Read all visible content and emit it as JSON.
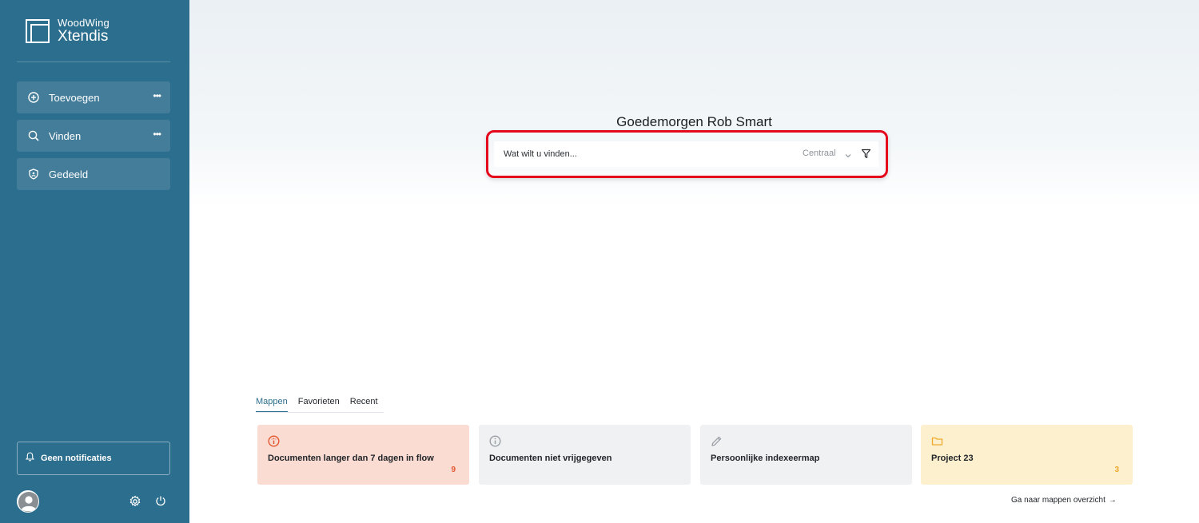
{
  "brand": {
    "line1": "WoodWing",
    "line2": "Xtendis",
    "logo_icon": "xtendis-logo-icon"
  },
  "sidebar": {
    "items": [
      {
        "label": "Toevoegen",
        "icon": "plus-circle-icon",
        "more": "•••"
      },
      {
        "label": "Vinden",
        "icon": "search-icon",
        "more": "•••"
      },
      {
        "label": "Gedeeld",
        "icon": "shield-icon"
      }
    ],
    "notifications_label": "Geen notificaties",
    "notifications_icon": "bell-icon",
    "avatar_icon": "user-avatar-icon",
    "settings_icon": "gear-icon",
    "power_icon": "power-icon"
  },
  "main": {
    "greeting": "Goedemorgen Rob Smart",
    "search": {
      "placeholder": "Wat wilt u vinden...",
      "scope": "Centraal",
      "filter_icon": "filter-icon"
    },
    "tabs": [
      {
        "label": "Mappen",
        "active": true
      },
      {
        "label": "Favorieten",
        "active": false
      },
      {
        "label": "Recent",
        "active": false
      }
    ],
    "cards": [
      {
        "title": "Documenten langer dan 7 dagen in flow",
        "count": "9",
        "icon": "alert-info-icon",
        "color": "#fadcd2"
      },
      {
        "title": "Documenten niet vrijgegeven",
        "count": "",
        "icon": "info-icon",
        "color": "#f0f1f3"
      },
      {
        "title": "Persoonlijke indexeermap",
        "count": "",
        "icon": "pencil-icon",
        "color": "#f0f1f3"
      },
      {
        "title": "Project 23",
        "count": "3",
        "icon": "folder-icon",
        "color": "#fdf0cf"
      }
    ],
    "overview_link": "Ga naar mappen overzicht",
    "overview_arrow": "→"
  },
  "colors": {
    "sidebar": "#2c6e8e",
    "highlight": "#e5071b",
    "accent": "#2c6e8e"
  }
}
